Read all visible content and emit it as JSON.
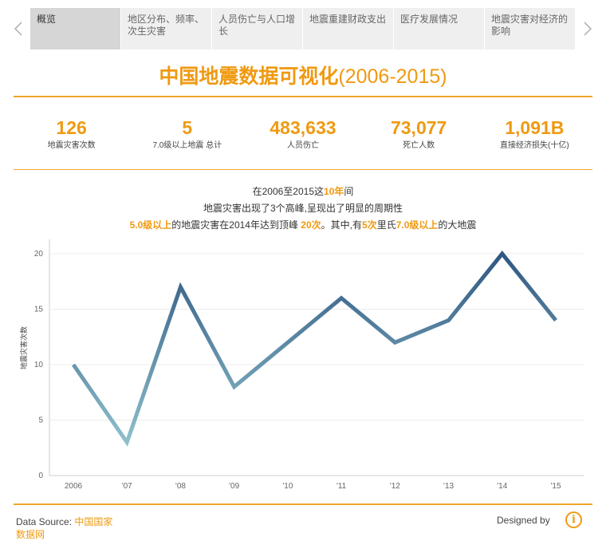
{
  "nav": {
    "prev_icon": "chevron-left-icon",
    "next_icon": "chevron-right-icon",
    "tabs": [
      {
        "label": "概览",
        "active": true
      },
      {
        "label": "地区分布、频率、次生灾害"
      },
      {
        "label": "人员伤亡与人口增长"
      },
      {
        "label": "地震重建财政支出"
      },
      {
        "label": "医疗发展情况"
      },
      {
        "label": "地震灾害对经济的影响"
      }
    ]
  },
  "header": {
    "title_main": "中国地震数据可视化",
    "title_years": "(2006-2015)"
  },
  "kpis": [
    {
      "value": "126",
      "label": "地震灾害次数"
    },
    {
      "value": "5",
      "label": "7.0级以上地震 总计"
    },
    {
      "value": "483,633",
      "label": "人员伤亡"
    },
    {
      "value": "73,077",
      "label": "死亡人数"
    },
    {
      "value": "1,091B",
      "label": "直接经济损失(十亿)"
    }
  ],
  "annotation": {
    "l1_a": "在2006至2015这",
    "l1_b": "10年",
    "l1_c": "间",
    "l2": "地震灾害出现了3个高峰,呈现出了明显的周期性",
    "l3_a": "5.0级以上",
    "l3_b": "的地震灾害在2014年达到顶峰 ",
    "l3_c": "20次",
    "l3_d": "。其中,有",
    "l3_e": "5次",
    "l3_f": "里氏",
    "l3_g": "7.0级以上",
    "l3_h": "的大地震"
  },
  "chart_data": {
    "type": "line",
    "categories": [
      "2006",
      "'07",
      "'08",
      "'09",
      "'10",
      "'11",
      "'12",
      "'13",
      "'14",
      "'15"
    ],
    "values": [
      10,
      3,
      17,
      8,
      12,
      16,
      12,
      14,
      20,
      14
    ],
    "ylabel": "地震灾害次数",
    "ylim": [
      0,
      22
    ],
    "yticks": [
      0,
      5,
      10,
      15,
      20
    ],
    "grid": true,
    "colors": {
      "low": "#9fd2d9",
      "high": "#2f5781",
      "grid": "#ececec",
      "axis": "#cccccc"
    }
  },
  "footer": {
    "source_label": "Data Source: ",
    "source_link": "中国国家",
    "source_link_cont": "数据网",
    "designed_by": "Designed by",
    "info_icon": "info-icon"
  },
  "colors": {
    "accent": "#ef9a12",
    "tab_bg": "#efefef",
    "tab_active_bg": "#d6d6d6"
  }
}
